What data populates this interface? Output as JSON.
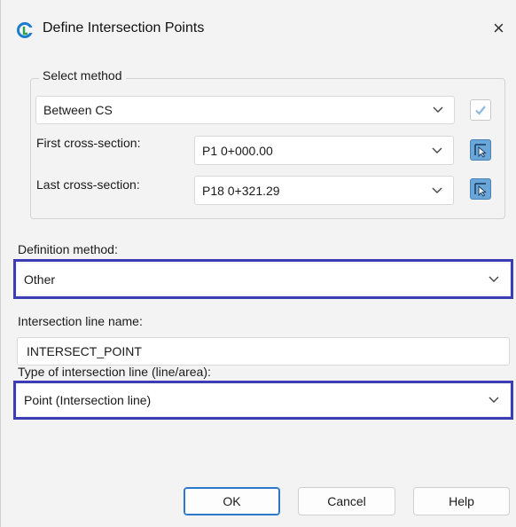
{
  "window": {
    "title": "Define Intersection Points",
    "close_glyph": "×",
    "app_icon": "app-logo-icon"
  },
  "select_method": {
    "legend": "Select method",
    "method_value": "Between CS",
    "first_label": "First cross-section:",
    "first_value": "P1 0+000.00",
    "last_label": "Last cross-section:",
    "last_value": "P18 0+321.29"
  },
  "definition": {
    "label": "Definition method:",
    "value": "Other"
  },
  "line_name": {
    "label": "Intersection line name:",
    "value": "INTERSECT_POINT"
  },
  "line_type": {
    "label": "Type of intersection line (line/area):",
    "value": "Point (Intersection line)"
  },
  "buttons": {
    "ok": "OK",
    "cancel": "Cancel",
    "help": "Help"
  },
  "colors": {
    "highlight": "#3c3cb4",
    "accent": "#2a78c9",
    "pick_button": "#6aa6d8"
  }
}
